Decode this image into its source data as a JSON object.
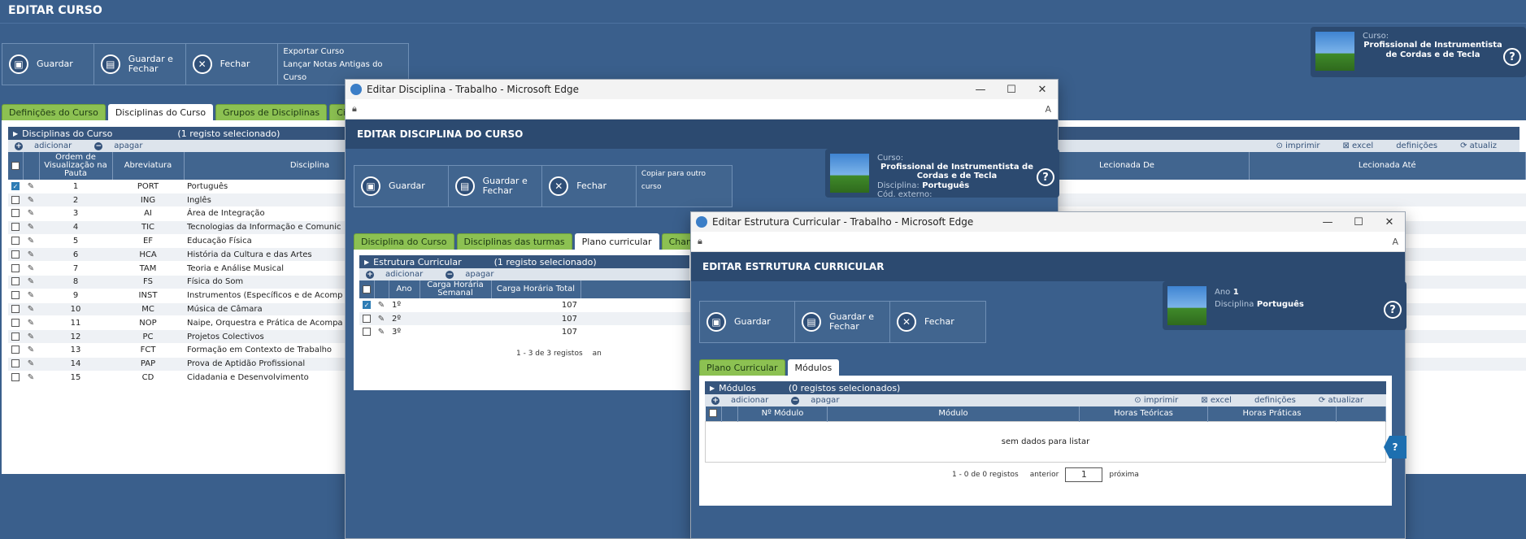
{
  "page": {
    "title": "EDITAR CURSO"
  },
  "main_toolbar": {
    "save": "Guardar",
    "save_close": "Guardar e Fechar",
    "close": "Fechar",
    "links": [
      "Exportar Curso",
      "Lançar Notas Antigas do Curso"
    ]
  },
  "course_info": {
    "label": "Curso:",
    "name": "Profissional de Instrumentista de Cordas e de Tecla"
  },
  "main_tabs": [
    "Definições do Curso",
    "Disciplinas do Curso",
    "Grupos de Disciplinas",
    "Ci"
  ],
  "disciplinas_panel": {
    "title": "Disciplinas do Curso",
    "selection": "(1 registo selecionado)",
    "add": "adicionar",
    "delete": "apagar",
    "right_actions": [
      "imprimir",
      "excel",
      "definições",
      "atualiz"
    ],
    "headers": {
      "ordem": "Ordem de Visualização na Pauta",
      "abrev": "Abreviatura",
      "disc": "Disciplina",
      "lecionada_de": "Lecionada De",
      "lecionada_ate": "Lecionada Até"
    },
    "rows": [
      {
        "n": "1",
        "abrev": "PORT",
        "disc": "Português",
        "checked": true
      },
      {
        "n": "2",
        "abrev": "ING",
        "disc": "Inglês"
      },
      {
        "n": "3",
        "abrev": "AI",
        "disc": "Área de Integração"
      },
      {
        "n": "4",
        "abrev": "TIC",
        "disc": "Tecnologias da Informação e Comunic"
      },
      {
        "n": "5",
        "abrev": "EF",
        "disc": "Educação Física"
      },
      {
        "n": "6",
        "abrev": "HCA",
        "disc": "História da Cultura e das Artes"
      },
      {
        "n": "7",
        "abrev": "TAM",
        "disc": "Teoria e Análise Musical"
      },
      {
        "n": "8",
        "abrev": "FS",
        "disc": "Física do Som"
      },
      {
        "n": "9",
        "abrev": "INST",
        "disc": "Instrumentos (Específicos e de Acomp"
      },
      {
        "n": "10",
        "abrev": "MC",
        "disc": "Música de Câmara"
      },
      {
        "n": "11",
        "abrev": "NOP",
        "disc": "Naipe, Orquestra e Prática de Acompa"
      },
      {
        "n": "12",
        "abrev": "PC",
        "disc": "Projetos Colectivos"
      },
      {
        "n": "13",
        "abrev": "FCT",
        "disc": "Formação em Contexto de Trabalho"
      },
      {
        "n": "14",
        "abrev": "PAP",
        "disc": "Prova de Aptidão Profissional"
      },
      {
        "n": "15",
        "abrev": "CD",
        "disc": "Cidadania e Desenvolvimento"
      }
    ]
  },
  "win1": {
    "title": "Editar Disciplina - Trabalho - Microsoft Edge",
    "page_title": "EDITAR DISCIPLINA DO CURSO",
    "save": "Guardar",
    "save_close": "Guardar e Fechar",
    "close": "Fechar",
    "copy": "Copiar para outro curso",
    "info": {
      "curso_label": "Curso:",
      "curso": "Profissional de Instrumentista de Cordas e de Tecla",
      "disc_label": "Disciplina:",
      "disc": "Português",
      "cod_label": "Cód. externo:"
    },
    "tabs": [
      "Disciplina do Curso",
      "Disciplinas das turmas",
      "Plano curricular",
      "Cham"
    ],
    "panel_title": "Estrutura Curricular",
    "selection": "(1 registo selecionado)",
    "add": "adicionar",
    "delete": "apagar",
    "headers": {
      "ano": "Ano",
      "semanal": "Carga Horária Semanal",
      "total": "Carga Horária Total"
    },
    "rows": [
      {
        "ano": "1º",
        "total": "107",
        "checked": true
      },
      {
        "ano": "2º",
        "total": "107"
      },
      {
        "ano": "3º",
        "total": "107"
      }
    ],
    "pager": "1 - 3 de 3 registos",
    "pager_prev": "an"
  },
  "win2": {
    "title": "Editar Estrutura Curricular - Trabalho - Microsoft Edge",
    "page_title": "EDITAR ESTRUTURA CURRICULAR",
    "save": "Guardar",
    "save_close": "Guardar e Fechar",
    "close": "Fechar",
    "info": {
      "ano_label": "Ano",
      "ano": "1",
      "disc_label": "Disciplina",
      "disc": "Português"
    },
    "tabs": [
      "Plano Curricular",
      "Módulos"
    ],
    "panel_title": "Módulos",
    "selection": "(0 registos selecionados)",
    "add": "adicionar",
    "delete": "apagar",
    "right_actions": [
      "imprimir",
      "excel",
      "definições",
      "atualizar"
    ],
    "headers": {
      "num": "Nº Módulo",
      "modulo": "Módulo",
      "teoricas": "Horas Teóricas",
      "praticas": "Horas Práticas"
    },
    "empty": "sem dados para listar",
    "pager": "1 - 0 de 0 registos",
    "prev": "anterior",
    "page": "1",
    "next": "próxima"
  }
}
